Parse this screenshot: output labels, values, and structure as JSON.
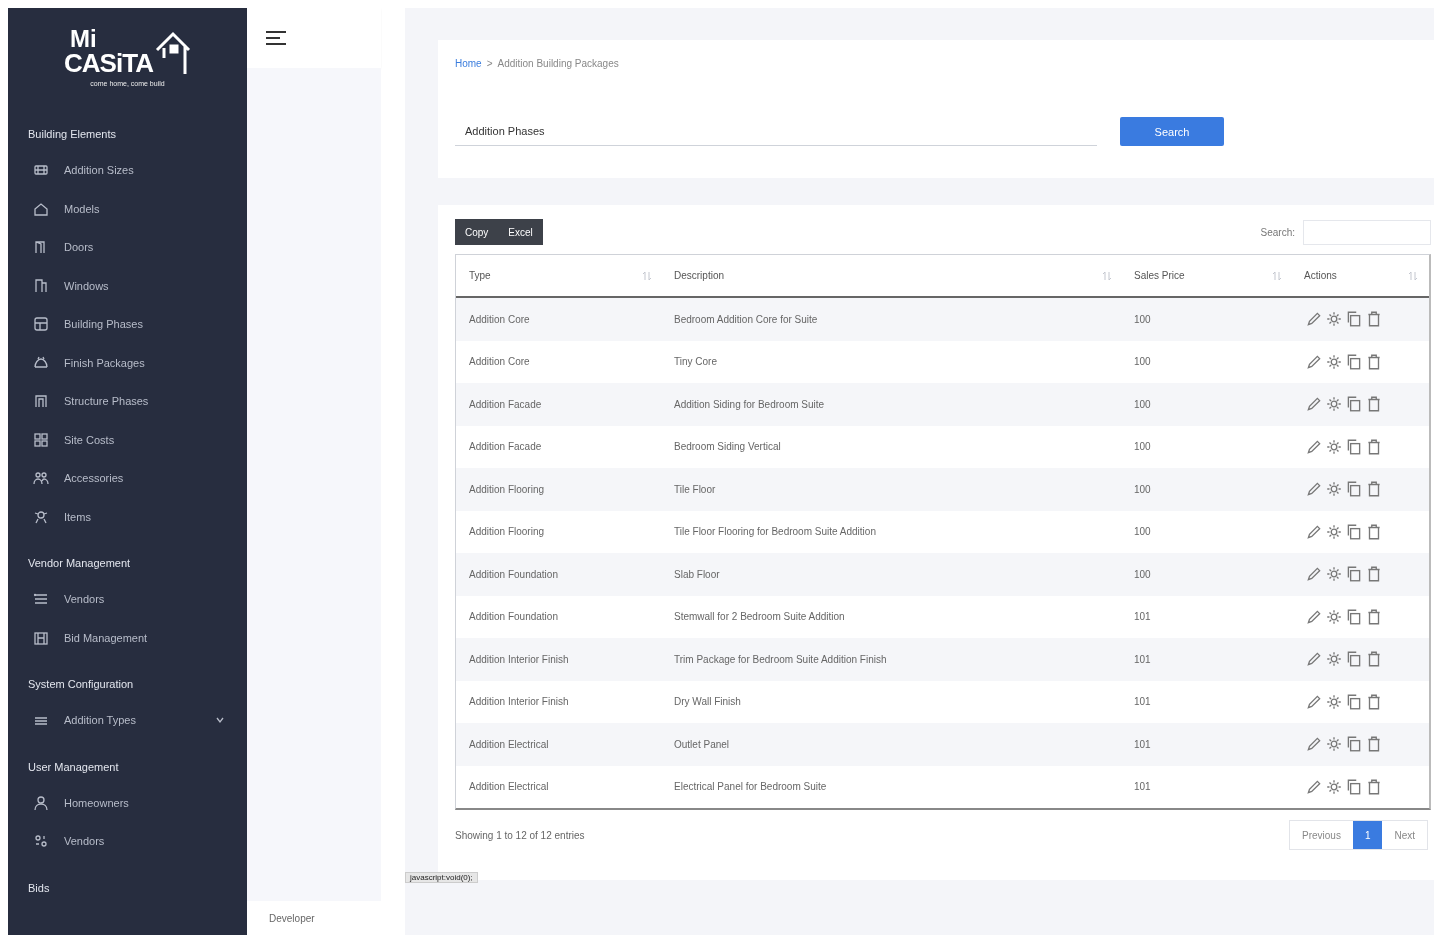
{
  "sidebar": {
    "logo": {
      "line_1": "Mi",
      "line_2": "CASiTA",
      "tagline": "come home, come build"
    },
    "sections": [
      {
        "title": "Building Elements",
        "items": [
          {
            "label": "Addition Sizes",
            "selected": false
          },
          {
            "label": "Models",
            "selected": false
          },
          {
            "label": "Doors",
            "selected": false
          },
          {
            "label": "Windows",
            "selected": false
          },
          {
            "label": "Building Phases",
            "selected": false
          },
          {
            "label": "Finish Packages",
            "selected": false
          },
          {
            "label": "Structure Phases",
            "selected": false
          },
          {
            "label": "Site Costs",
            "selected": false
          },
          {
            "label": "Accessories",
            "selected": false
          },
          {
            "label": "Items",
            "selected": false
          }
        ]
      },
      {
        "title": "Vendor Management",
        "items": [
          {
            "label": "Vendors",
            "selected": false
          },
          {
            "label": "Bid Management",
            "selected": false
          }
        ]
      },
      {
        "title": "System Configuration",
        "items": [
          {
            "label": "Addition Types",
            "selected": false,
            "expanded": false
          }
        ]
      },
      {
        "title": "User Management",
        "items": [
          {
            "label": "Homeowners",
            "selected": false
          },
          {
            "label": "Vendors",
            "selected": false
          }
        ]
      },
      {
        "title": "Bids"
      }
    ]
  },
  "header_column": {
    "footer": "Developer"
  },
  "breadcrumb": {
    "home": "Home",
    "separator": ">",
    "current": "Addition Building Packages"
  },
  "filter": {
    "value": "Addition Phases",
    "button": "Search"
  },
  "export_buttons": [
    "Copy",
    "Excel"
  ],
  "search": {
    "label": "Search:"
  },
  "table": {
    "columns": [
      "Type",
      "Description",
      "Sales Price",
      "Actions"
    ],
    "rows": [
      {
        "type": "Addition Core",
        "description": "Bedroom Addition Core for Suite",
        "price": "100"
      },
      {
        "type": "Addition Core",
        "description": "Tiny Core",
        "price": "100"
      },
      {
        "type": "Addition Facade",
        "description": "Addition Siding for Bedroom Suite",
        "price": "100"
      },
      {
        "type": "Addition Facade",
        "description": "Bedroom Siding Vertical",
        "price": "100"
      },
      {
        "type": "Addition Flooring",
        "description": "Tile Floor",
        "price": "100"
      },
      {
        "type": "Addition Flooring",
        "description": "Tile Floor Flooring for Bedroom Suite Addition",
        "price": "100"
      },
      {
        "type": "Addition Foundation",
        "description": "Slab Floor",
        "price": "100"
      },
      {
        "type": "Addition Foundation",
        "description": "Stemwall for 2 Bedroom Suite Addition",
        "price": "101"
      },
      {
        "type": "Addition Interior Finish",
        "description": "Trim Package for Bedroom Suite Addition Finish",
        "price": "101"
      },
      {
        "type": "Addition Interior Finish",
        "description": "Dry Wall Finish",
        "price": "101"
      },
      {
        "type": "Addition Electrical",
        "description": "Outlet Panel",
        "price": "101"
      },
      {
        "type": "Addition Electrical",
        "description": "Electrical Panel for Bedroom Suite",
        "price": "101"
      }
    ]
  },
  "footer": {
    "info": "Showing 1 to 12 of 12 entries",
    "pagination": [
      {
        "label": "Previous",
        "selected": false
      },
      {
        "label": "1",
        "selected": true
      },
      {
        "label": "Next",
        "selected": false
      }
    ]
  },
  "status_bar": "javascript:void(0);"
}
